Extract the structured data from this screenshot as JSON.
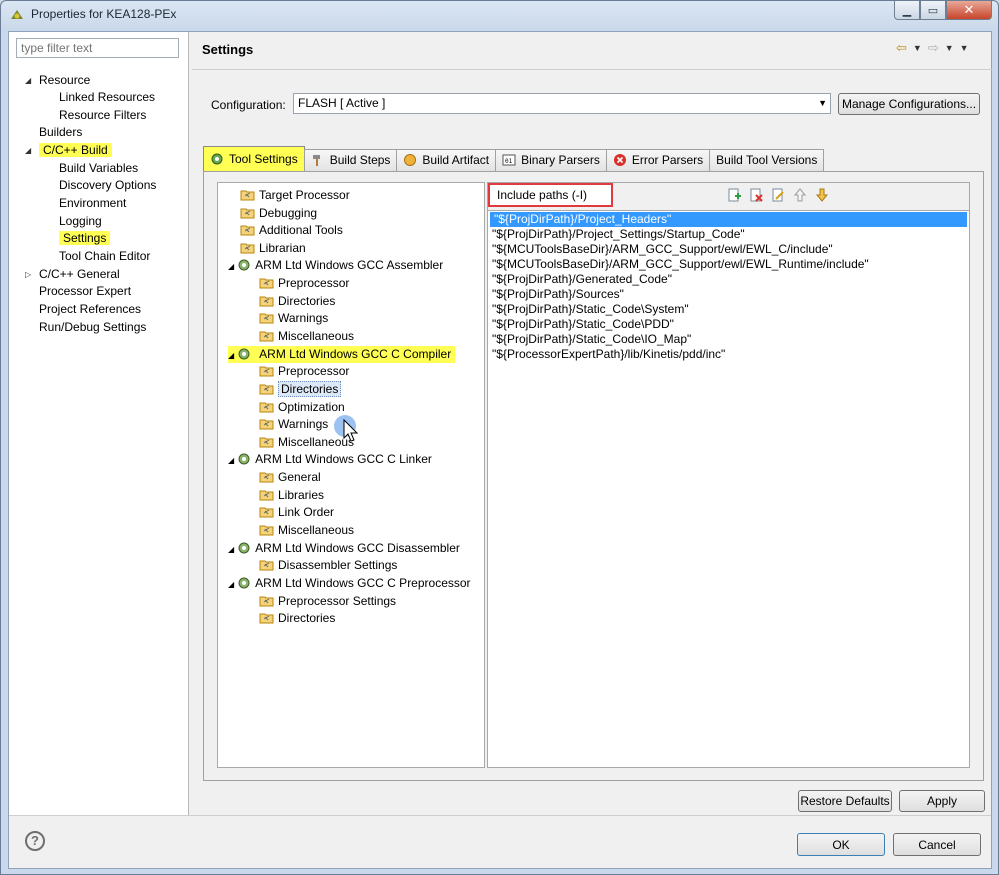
{
  "window": {
    "title": "Properties for KEA128-PEx"
  },
  "filter": {
    "placeholder": "type filter text"
  },
  "nav": {
    "items": [
      {
        "label": "Resource",
        "twisty": "expanded"
      },
      {
        "label": "Linked Resources"
      },
      {
        "label": "Resource Filters"
      },
      {
        "label": "Builders"
      },
      {
        "label": "C/C++ Build",
        "twisty": "expanded",
        "highlight": true
      },
      {
        "label": "Build Variables"
      },
      {
        "label": "Discovery Options"
      },
      {
        "label": "Environment"
      },
      {
        "label": "Logging"
      },
      {
        "label": "Settings",
        "highlight": true
      },
      {
        "label": "Tool Chain Editor"
      },
      {
        "label": "C/C++ General",
        "twisty": "collapsed"
      },
      {
        "label": "Processor Expert"
      },
      {
        "label": "Project References"
      },
      {
        "label": "Run/Debug Settings"
      }
    ]
  },
  "page": {
    "title": "Settings"
  },
  "config": {
    "label": "Configuration:",
    "value": "FLASH  [ Active ]",
    "manage_label": "Manage Configurations..."
  },
  "tabs": [
    {
      "label": "Tool Settings",
      "active": true
    },
    {
      "label": "Build Steps"
    },
    {
      "label": "Build Artifact"
    },
    {
      "label": "Binary Parsers"
    },
    {
      "label": "Error Parsers"
    },
    {
      "label": "Build Tool Versions"
    }
  ],
  "tooltree": [
    {
      "label": "Target Processor"
    },
    {
      "label": "Debugging"
    },
    {
      "label": "Additional Tools"
    },
    {
      "label": "Librarian"
    },
    {
      "label": "ARM Ltd Windows GCC Assembler"
    },
    {
      "label": "Preprocessor"
    },
    {
      "label": "Directories"
    },
    {
      "label": "Warnings"
    },
    {
      "label": "Miscellaneous"
    },
    {
      "label": "ARM Ltd Windows GCC C Compiler",
      "highlight": true
    },
    {
      "label": "Preprocessor"
    },
    {
      "label": "Directories",
      "selected": true
    },
    {
      "label": "Optimization"
    },
    {
      "label": "Warnings"
    },
    {
      "label": "Miscellaneous"
    },
    {
      "label": "ARM Ltd Windows GCC C Linker"
    },
    {
      "label": "General"
    },
    {
      "label": "Libraries"
    },
    {
      "label": "Link Order"
    },
    {
      "label": "Miscellaneous"
    },
    {
      "label": "ARM Ltd Windows GCC Disassembler"
    },
    {
      "label": "Disassembler Settings"
    },
    {
      "label": "ARM Ltd Windows GCC C Preprocessor"
    },
    {
      "label": "Preprocessor Settings"
    },
    {
      "label": "Directories"
    }
  ],
  "include": {
    "label": "Include paths (-I)",
    "paths": [
      "\"${ProjDirPath}/Project_Headers\"",
      "\"${ProjDirPath}/Project_Settings/Startup_Code\"",
      "\"${MCUToolsBaseDir}/ARM_GCC_Support/ewl/EWL_C/include\"",
      "\"${MCUToolsBaseDir}/ARM_GCC_Support/ewl/EWL_Runtime/include\"",
      "\"${ProjDirPath}/Generated_Code\"",
      "\"${ProjDirPath}/Sources\"",
      "\"${ProjDirPath}/Static_Code\\System\"",
      "\"${ProjDirPath}/Static_Code\\PDD\"",
      "\"${ProjDirPath}/Static_Code\\IO_Map\"",
      "\"${ProcessorExpertPath}/lib/Kinetis/pdd/inc\""
    ]
  },
  "buttons": {
    "restore": "Restore Defaults",
    "apply": "Apply",
    "ok": "OK",
    "cancel": "Cancel"
  },
  "help": {
    "glyph": "?"
  },
  "colors": {
    "highlight": "#ffff54",
    "selection": "#3399ff",
    "callout": "#e0393e"
  }
}
